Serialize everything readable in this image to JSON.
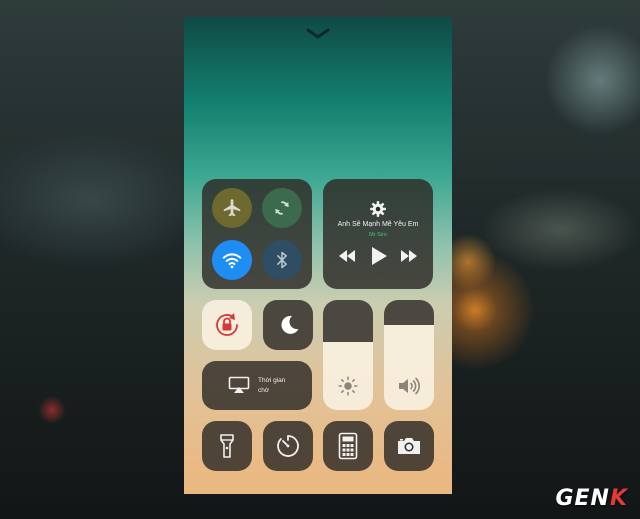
{
  "control_center": {
    "media": {
      "song_title": "Anh Sẽ Mạnh Mẽ Yêu Em",
      "artist": "Mr Siro"
    },
    "screen_mirroring": {
      "label_line1": "Thời gian",
      "label_line2": "chờ"
    },
    "sliders": {
      "brightness_level": 0.62,
      "volume_level": 0.77
    },
    "toggles": {
      "airplane_mode": false,
      "cellular_data": false,
      "wifi": true,
      "bluetooth": false,
      "rotation_lock": true,
      "do_not_disturb": false
    },
    "colors": {
      "wifi_active": "#1e8ef2",
      "rotation_lock_icon": "#d33a3a",
      "artist_text": "#3ecf7a"
    }
  },
  "watermark": {
    "text_main": "GEN",
    "text_accent": "K"
  }
}
